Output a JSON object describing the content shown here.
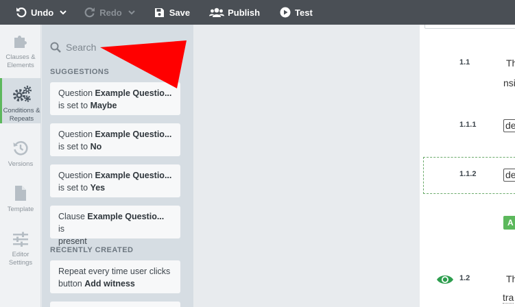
{
  "toolbar": {
    "undo": "Undo",
    "redo": "Redo",
    "save": "Save",
    "publish": "Publish",
    "test": "Test"
  },
  "rail": {
    "items": [
      {
        "label": "Clauses & Elements",
        "icon": "puzzle-icon"
      },
      {
        "label": "Conditions & Repeats",
        "icon": "gears-icon",
        "active": true
      },
      {
        "label": "Versions",
        "icon": "history-icon"
      },
      {
        "label": "Template",
        "icon": "file-icon"
      },
      {
        "label": "Editor Settings",
        "icon": "sliders-icon"
      }
    ]
  },
  "panel": {
    "search_placeholder": "Search",
    "suggestions_title": "SUGGESTIONS",
    "suggestions": [
      {
        "prefix": "Question",
        "name": "Example Questio...",
        "suffix": "is set to",
        "value": "Maybe"
      },
      {
        "prefix": "Question",
        "name": "Example Questio...",
        "suffix": "is set to",
        "value": "No"
      },
      {
        "prefix": "Question",
        "name": "Example Questio...",
        "suffix": "is set to",
        "value": "Yes"
      },
      {
        "prefix": "Clause",
        "name": "Example Questio...",
        "suffix": "is",
        "value": "present"
      }
    ],
    "recent_title": "RECENTLY CREATED",
    "recent": [
      {
        "prefix": "Repeat every time user clicks button",
        "value": "Add witness"
      }
    ]
  },
  "document": {
    "items": [
      {
        "number": "1.1",
        "text": "Th",
        "text2": "nsi"
      },
      {
        "number": "1.1.1",
        "boxed": "de"
      },
      {
        "number": "1.1.2",
        "boxed": "de"
      },
      {
        "tag": "A"
      },
      {
        "number": "1.2",
        "text": "Th",
        "text2": "tra"
      }
    ]
  },
  "colors": {
    "toolbar": "#4a4f55",
    "accent_green": "#5cb85c",
    "annotation_red": "#ff0000"
  }
}
